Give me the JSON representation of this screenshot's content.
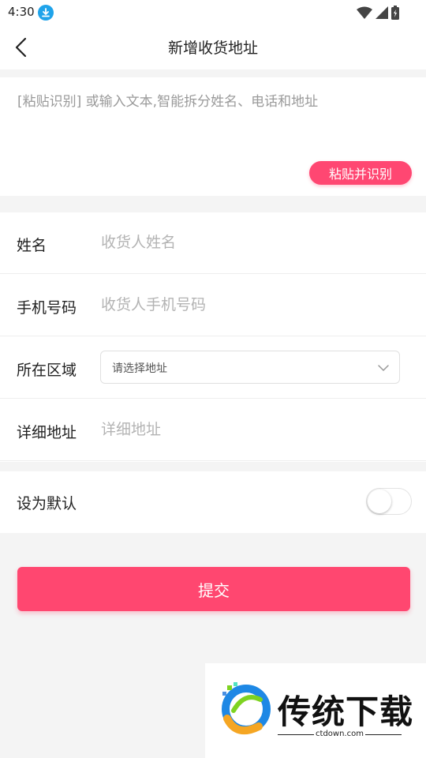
{
  "status_bar": {
    "time": "4:30",
    "download_icon": "download-icon",
    "wifi_icon": "wifi-icon",
    "signal_icon": "signal-icon",
    "battery_icon": "battery-charging-icon"
  },
  "nav": {
    "back_icon": "chevron-left-icon",
    "title": "新增收货地址"
  },
  "paste": {
    "placeholder": "[粘贴识别] 或输入文本,智能拆分姓名、电话和地址",
    "button_label": "粘贴并识别"
  },
  "form": {
    "name": {
      "label": "姓名",
      "placeholder": "收货人姓名",
      "value": ""
    },
    "phone": {
      "label": "手机号码",
      "placeholder": "收货人手机号码",
      "value": ""
    },
    "region": {
      "label": "所在区域",
      "placeholder": "请选择地址",
      "icon": "chevron-down-icon"
    },
    "address": {
      "label": "详细地址",
      "placeholder": "详细地址",
      "value": ""
    }
  },
  "default_setting": {
    "label": "设为默认",
    "enabled": false
  },
  "submit": {
    "label": "提交"
  },
  "watermark": {
    "title": "传统下载",
    "url": "ctdown.com"
  },
  "colors": {
    "accent": "#ff4770",
    "status_icon": "#1fa3ea",
    "background": "#f4f4f4"
  }
}
